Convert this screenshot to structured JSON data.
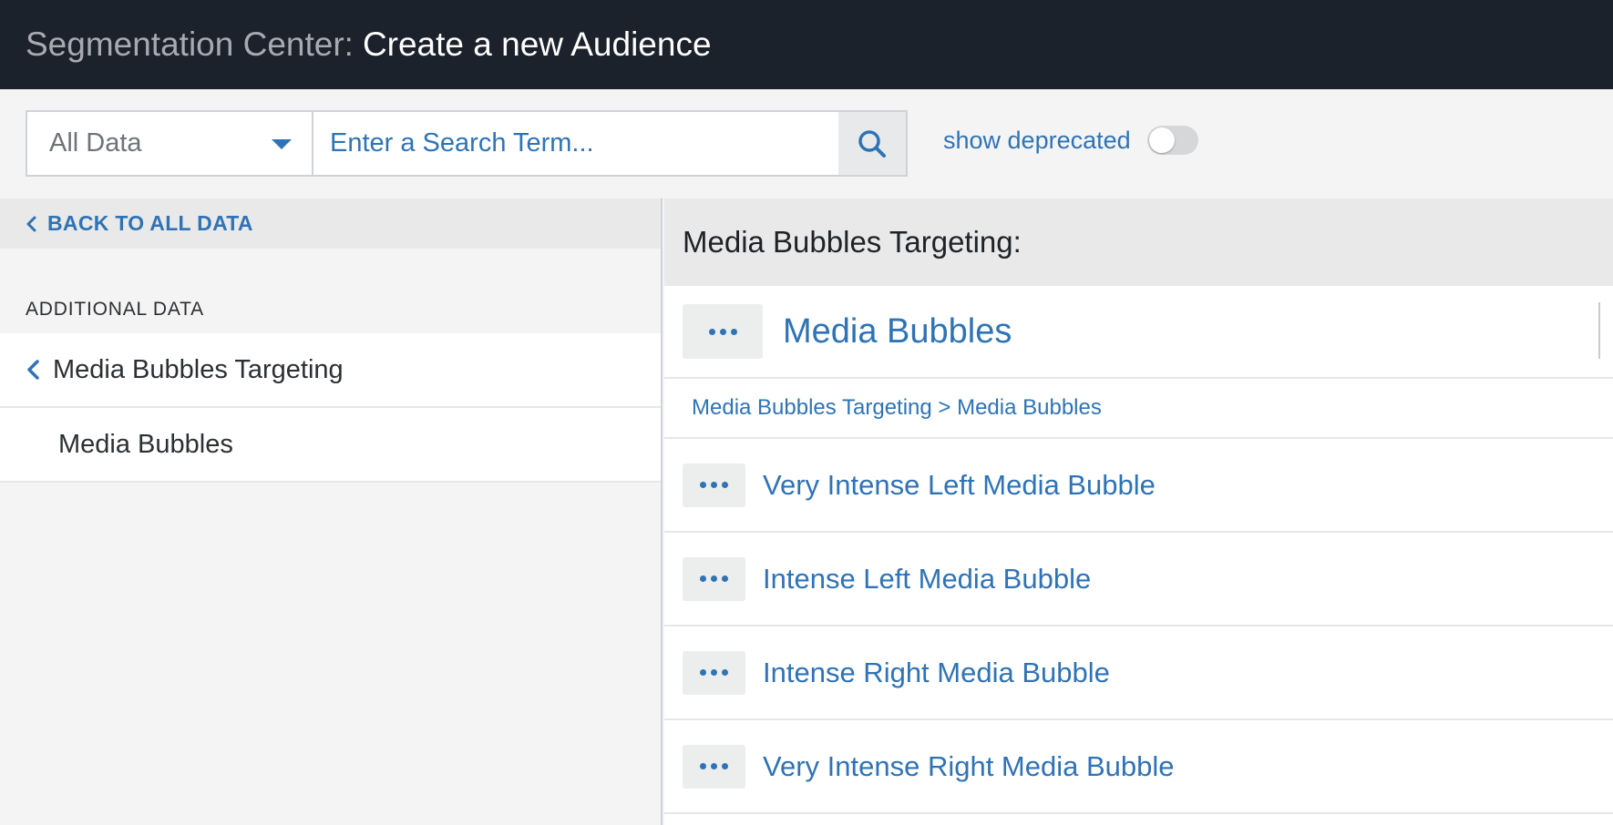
{
  "header": {
    "prefix": "Segmentation Center:",
    "title": "Create a new Audience"
  },
  "toolbar": {
    "data_select": {
      "selected": "All Data"
    },
    "search": {
      "placeholder": "Enter a Search Term...",
      "value": ""
    },
    "show_deprecated": {
      "label": "show deprecated",
      "on": false
    }
  },
  "sidebar": {
    "back_label": "BACK TO ALL DATA",
    "section_title": "ADDITIONAL DATA",
    "items": [
      {
        "label": "Media Bubbles Targeting",
        "type": "parent"
      },
      {
        "label": "Media Bubbles",
        "type": "child"
      }
    ]
  },
  "main": {
    "header": "Media Bubbles Targeting:",
    "current": {
      "label": "Media Bubbles"
    },
    "breadcrumb": "Media Bubbles Targeting > Media Bubbles",
    "items": [
      {
        "label": "Very Intense Left Media Bubble"
      },
      {
        "label": "Intense Left Media Bubble"
      },
      {
        "label": "Intense Right Media Bubble"
      },
      {
        "label": "Very Intense Right Media Bubble"
      }
    ]
  },
  "colors": {
    "header_bg": "#1c222b",
    "accent": "#2f73b5",
    "panel_bg": "#f4f4f4"
  },
  "icons": {
    "search": "search-icon",
    "caret": "caret-down-icon",
    "back": "chevron-left-icon",
    "more": "more-dots-icon"
  }
}
